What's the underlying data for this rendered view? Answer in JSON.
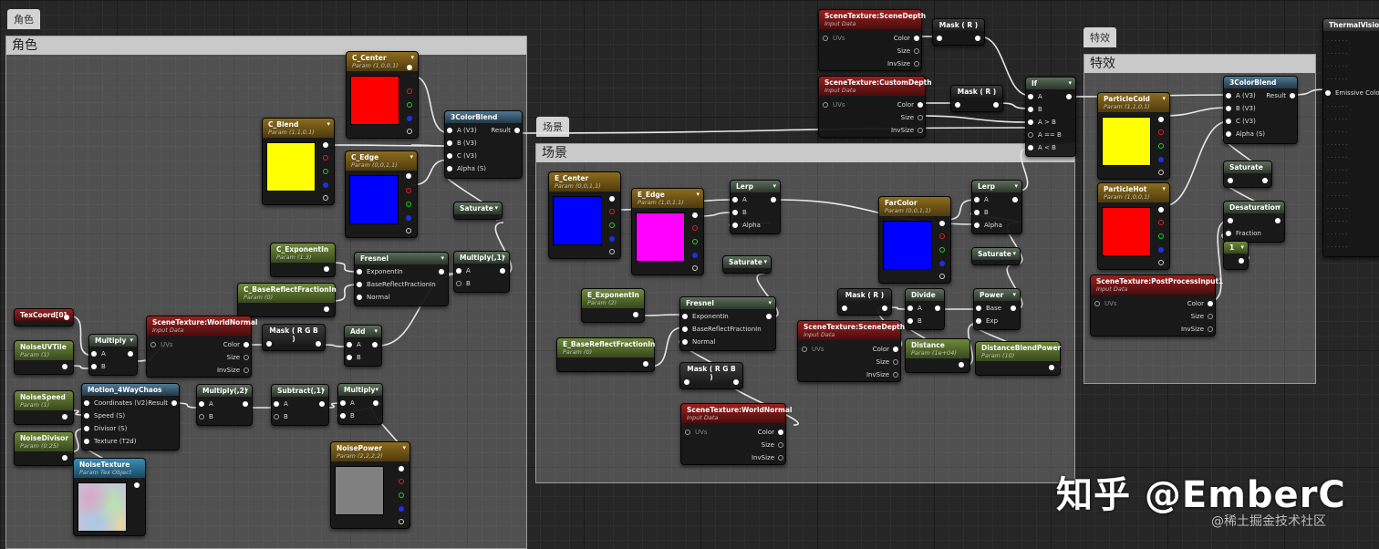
{
  "groups": [
    {
      "label": "角色",
      "tab_label": "角色"
    },
    {
      "label": "场景",
      "tab_label": "场景"
    },
    {
      "label": "特效",
      "tab_label": "特效"
    }
  ],
  "nodes": {
    "c_center": {
      "title": "C_Center",
      "subtitle": "Param (1,0,0,1)",
      "color": "#ff0000"
    },
    "c_blend": {
      "title": "C_Blend",
      "subtitle": "Param (1,1,0,1)",
      "color": "#ffff00"
    },
    "c_edge": {
      "title": "C_Edge",
      "subtitle": "Param (0,0,1,1)",
      "color": "#0000ff"
    },
    "color_blend_c": {
      "title": "3ColorBlend",
      "pins": [
        "A (V3)",
        "B (V3)",
        "C (V3)",
        "Alpha (S)"
      ],
      "output": "Result"
    },
    "saturate_c": {
      "title": "Saturate"
    },
    "c_exponent": {
      "title": "C_ExponentIn",
      "subtitle": "Param (1.3)"
    },
    "c_basereflect": {
      "title": "C_BaseReflectFractionIn",
      "subtitle": "Param (0)"
    },
    "fresnel_c": {
      "title": "Fresnel",
      "pins": [
        "ExponentIn",
        "BaseReflectFractionIn",
        "Normal"
      ]
    },
    "multiply_c1": {
      "title": "Multiply(,1)",
      "pins": [
        "A",
        "B"
      ]
    },
    "texcoord": {
      "title": "TexCoord[0]"
    },
    "noise_uvtile": {
      "title": "NoiseUVTile",
      "subtitle": "Param (1)"
    },
    "multiply_c2": {
      "title": "Multiply",
      "pins": [
        "A",
        "B"
      ]
    },
    "worldnormal_c": {
      "title": "SceneTexture:WorldNormal",
      "subtitle": "Input Data",
      "pins": [
        "UVs"
      ],
      "outputs": [
        "Color",
        "Size",
        "InvSize"
      ]
    },
    "mask_rgb_c": {
      "title": "Mask ( R G B )"
    },
    "add_c": {
      "title": "Add",
      "pins": [
        "A",
        "B"
      ]
    },
    "noise_speed": {
      "title": "NoiseSpeed",
      "subtitle": "Param (1)"
    },
    "motion": {
      "title": "Motion_4WayChaos",
      "pins": [
        "Coordinates (V2)",
        "Speed (S)",
        "Divisor (S)",
        "Texture (T2d)"
      ],
      "output": "Result"
    },
    "multiply_c3": {
      "title": "Multiply(,2)",
      "pins": [
        "A",
        "B"
      ]
    },
    "subtract_c": {
      "title": "Subtract(,1)",
      "pins": [
        "A",
        "B"
      ]
    },
    "multiply_c4": {
      "title": "Multiply",
      "pins": [
        "A",
        "B"
      ]
    },
    "noise_divisor": {
      "title": "NoiseDivisor",
      "subtitle": "Param (0.25)"
    },
    "noise_texture": {
      "title": "NoiseTexture",
      "subtitle": "Param Tex Object"
    },
    "noise_power": {
      "title": "NoisePower",
      "subtitle": "Param (2,2,2,2)",
      "color": "#808080"
    },
    "e_center": {
      "title": "E_Center",
      "subtitle": "Param (0,0,1,1)",
      "color": "#0000ff"
    },
    "e_edge": {
      "title": "E_Edge",
      "subtitle": "Param (1,0,1,1)",
      "color": "#ff00ff"
    },
    "lerp_e1": {
      "title": "Lerp",
      "pins": [
        "A",
        "B",
        "Alpha"
      ]
    },
    "saturate_e1": {
      "title": "Saturate"
    },
    "e_exponent": {
      "title": "E_ExponentIn",
      "subtitle": "Param (2)"
    },
    "e_basereflect": {
      "title": "E_BaseReflectFractionIn",
      "subtitle": "Param (0)"
    },
    "fresnel_e": {
      "title": "Fresnel",
      "pins": [
        "ExponentIn",
        "BaseReflectFractionIn",
        "Normal"
      ]
    },
    "mask_rgb_e": {
      "title": "Mask ( R G B )"
    },
    "worldnormal_e": {
      "title": "SceneTexture:WorldNormal",
      "subtitle": "Input Data",
      "pins": [
        "UVs"
      ],
      "outputs": [
        "Color",
        "Size",
        "InvSize"
      ]
    },
    "farcolor": {
      "title": "FarColor",
      "subtitle": "Param (0,0,1,1)",
      "color": "#0000ff"
    },
    "lerp_e2": {
      "title": "Lerp",
      "pins": [
        "A",
        "B",
        "Alpha"
      ]
    },
    "saturate_e2": {
      "title": "Saturate"
    },
    "mask_r_e": {
      "title": "Mask ( R )"
    },
    "divide_e": {
      "title": "Divide",
      "pins": [
        "A",
        "B"
      ]
    },
    "power_e": {
      "title": "Power",
      "pins": [
        "Base",
        "Exp"
      ]
    },
    "scenedepth_e": {
      "title": "SceneTexture:SceneDepth",
      "subtitle": "Input Data",
      "pins": [
        "UVs"
      ],
      "outputs": [
        "Color",
        "Size",
        "InvSize"
      ]
    },
    "distance_e": {
      "title": "Distance",
      "subtitle": "Param (1e+04)"
    },
    "distblendpower": {
      "title": "DistanceBlendPower",
      "subtitle": "Param (10)"
    },
    "scenedepth_top": {
      "title": "SceneTexture:SceneDepth",
      "subtitle": "Input Data",
      "pins": [
        "UVs"
      ],
      "outputs": [
        "Color",
        "Size",
        "InvSize"
      ]
    },
    "mask_r_top": {
      "title": "Mask ( R )"
    },
    "customdepth": {
      "title": "SceneTexture:CustomDepth",
      "subtitle": "Input Data",
      "pins": [
        "UVs"
      ],
      "outputs": [
        "Color",
        "Size",
        "InvSize"
      ]
    },
    "mask_r_top2": {
      "title": "Mask ( R )"
    },
    "if_node": {
      "title": "If",
      "pins": [
        "A",
        "B",
        "A > B",
        "A == B",
        "A < B"
      ]
    },
    "particle_cold": {
      "title": "ParticleCold",
      "subtitle": "Param (1,1,0,1)",
      "color": "#ffff00"
    },
    "particle_hot": {
      "title": "ParticleHot",
      "subtitle": "Param (1,0,0,1)",
      "color": "#ff0000"
    },
    "color_blend_fx": {
      "title": "3ColorBlend",
      "pins": [
        "A (V3)",
        "B (V3)",
        "C (V3)",
        "Alpha (S)"
      ],
      "output": "Result"
    },
    "saturate_fx": {
      "title": "Saturate"
    },
    "desaturation": {
      "title": "Desaturation",
      "pins": [
        "Fraction"
      ]
    },
    "const_one": {
      "title": "1"
    },
    "postprocess": {
      "title": "SceneTexture:PostProcessInput1",
      "subtitle": "Input Data",
      "pins": [
        "UVs"
      ],
      "outputs": [
        "Color",
        "Size",
        "InvSize"
      ]
    },
    "thermal": {
      "title": "ThermalVision",
      "emissive": "Emissive Color"
    }
  },
  "watermark": {
    "main": "知乎 @EmberC",
    "secondary": "@稀土掘金技术社区"
  },
  "colors": {
    "wire": "#e8e8e8",
    "param_header": "#8d6c1d",
    "texture_header": "#9a2020",
    "scalar_header": "#6e8a3c"
  }
}
